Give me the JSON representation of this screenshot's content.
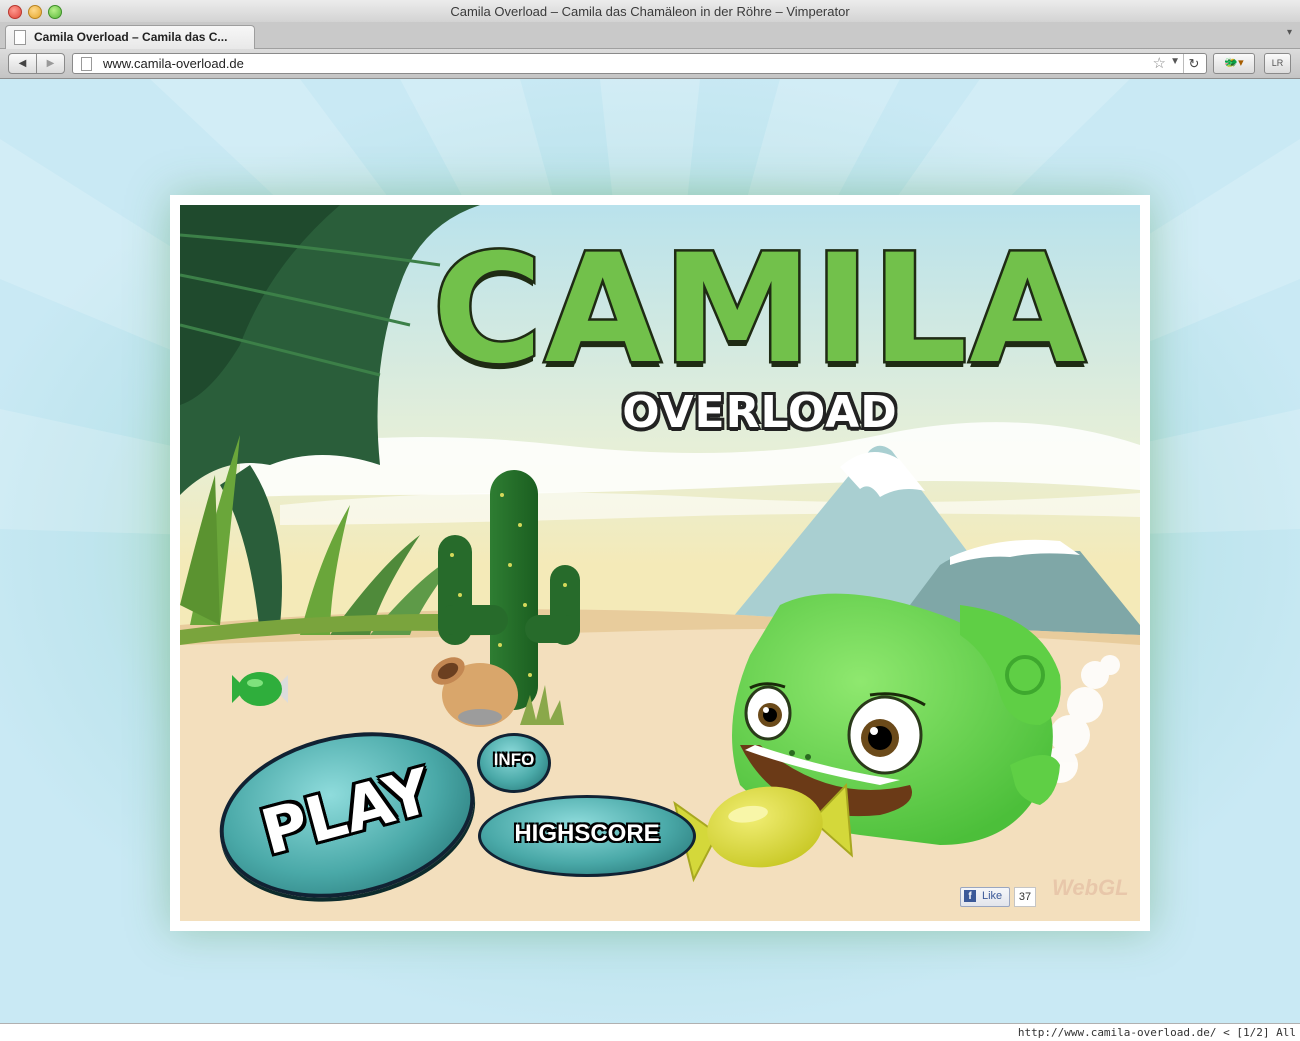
{
  "window": {
    "title": "Camila Overload – Camila das Chamäleon in der Röhre – Vimperator"
  },
  "tab": {
    "label": "Camila Overload – Camila das C..."
  },
  "nav": {
    "back": "◀",
    "forward": "▶",
    "url": "www.camila-overload.de",
    "star": "☆",
    "dropdown": "▼",
    "reload": "↻",
    "ext": "🐲▾",
    "lr": "LR"
  },
  "game": {
    "title": "CAMILA",
    "subtitle": "OVERLOAD",
    "buttons": {
      "play": "PLAY",
      "info": "INFO",
      "highscore": "HIGHSCORE"
    },
    "facebook": {
      "like": "Like",
      "count": "37",
      "icon": "f"
    },
    "webgl": "WebGL"
  },
  "status": {
    "text": "http://www.camila-overload.de/ < [1/2] All"
  }
}
